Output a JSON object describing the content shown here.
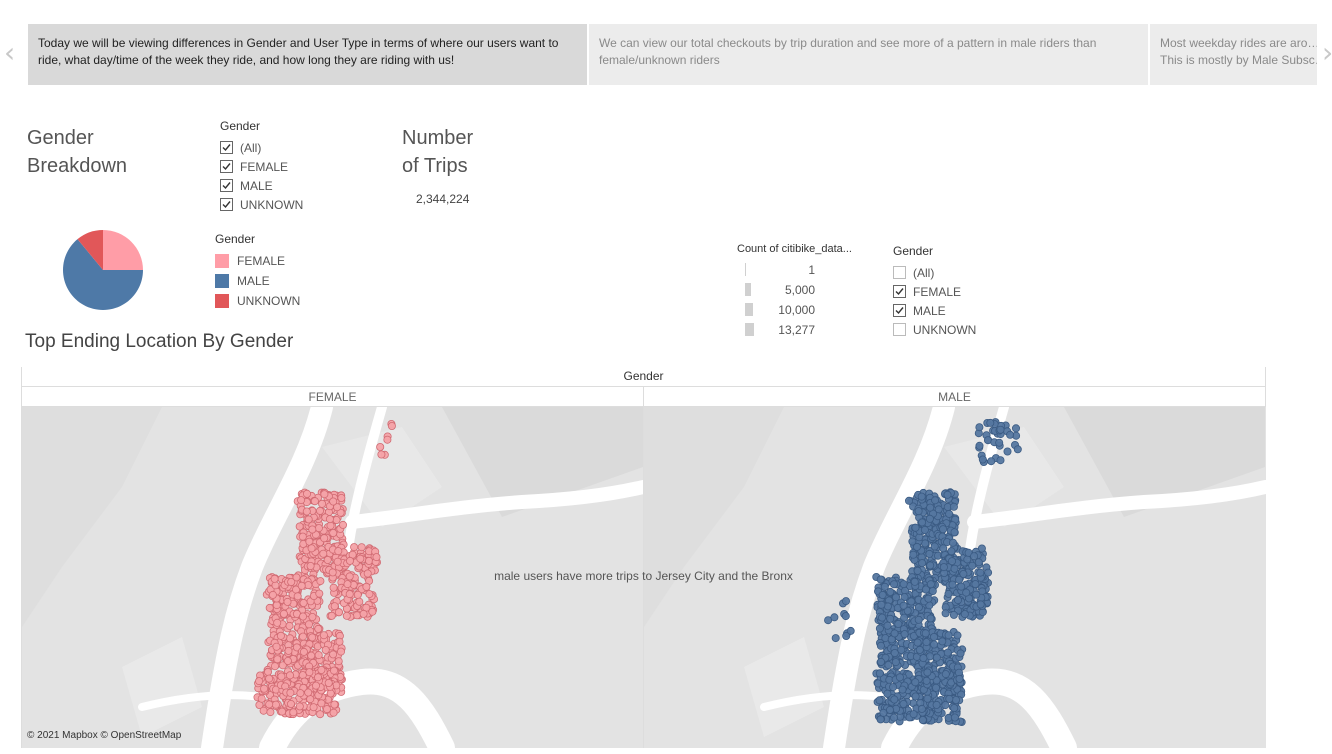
{
  "story": {
    "prev_arrow": "‹",
    "next_arrow": "›",
    "points": [
      {
        "text": "Today we will be viewing differences in Gender and User Type in terms of where our users want to ride, what day/time of the week they ride, and how long they are riding with us!"
      },
      {
        "text": "We can view our total checkouts by trip duration and see more of a pattern in male riders than female/unknown riders"
      },
      {
        "text": "Most weekday rides are aro… This is mostly by Male Subsc…"
      }
    ]
  },
  "gender_breakdown": {
    "title_line1": "Gender",
    "title_line2": "Breakdown",
    "chart_data": {
      "type": "pie",
      "categories": [
        "FEMALE",
        "MALE",
        "UNKNOWN"
      ],
      "values": [
        25,
        64,
        11
      ],
      "colors": [
        "#ff9da7",
        "#4e79a7",
        "#e15759"
      ],
      "title": "Gender Breakdown"
    }
  },
  "gender_filter_top": {
    "title": "Gender",
    "options": [
      {
        "label": "(All)",
        "checked": true
      },
      {
        "label": "FEMALE",
        "checked": true
      },
      {
        "label": "MALE",
        "checked": true
      },
      {
        "label": "UNKNOWN",
        "checked": true
      }
    ]
  },
  "trips": {
    "title_line1": "Number",
    "title_line2": "of Trips",
    "value": "2,344,224"
  },
  "color_legend": {
    "title": "Gender",
    "items": [
      {
        "label": "FEMALE",
        "color": "#ff9da7"
      },
      {
        "label": "MALE",
        "color": "#4e79a7"
      },
      {
        "label": "UNKNOWN",
        "color": "#e15759"
      }
    ]
  },
  "size_legend": {
    "title": "Count of citibike_data...",
    "items": [
      {
        "label": "1",
        "value": 1
      },
      {
        "label": "5,000",
        "value": 5000
      },
      {
        "label": "10,000",
        "value": 10000
      },
      {
        "label": "13,277",
        "value": 13277
      }
    ]
  },
  "gender_filter_map": {
    "title": "Gender",
    "options": [
      {
        "label": "(All)",
        "checked": false
      },
      {
        "label": "FEMALE",
        "checked": true
      },
      {
        "label": "MALE",
        "checked": true
      },
      {
        "label": "UNKNOWN",
        "checked": false
      }
    ]
  },
  "map": {
    "title": "Top Ending Location By Gender",
    "column_header": "Gender",
    "panels": [
      {
        "label": "FEMALE",
        "color": "#f4a3a8",
        "stroke": "#d06a72"
      },
      {
        "label": "MALE",
        "color": "#5577a0",
        "stroke": "#3a5a82"
      }
    ],
    "annotation": "male users have more trips to Jersey City and the Bronx",
    "attribution": "© 2021 Mapbox © OpenStreetMap",
    "land_color": "#e3e3e3",
    "water_color": "#ffffff"
  }
}
